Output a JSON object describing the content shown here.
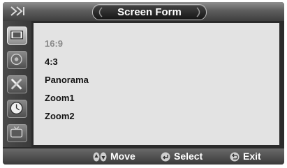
{
  "header": {
    "title": "Screen Form",
    "logo_icon": "play-chevrons-icon"
  },
  "sidebar": {
    "items": [
      {
        "icon": "picture-icon",
        "active": true
      },
      {
        "icon": "sound-icon",
        "active": false
      },
      {
        "icon": "tools-icon",
        "active": false
      },
      {
        "icon": "clock-icon",
        "active": false
      },
      {
        "icon": "tv-icon",
        "active": false
      }
    ]
  },
  "menu": {
    "options": [
      {
        "label": "16:9",
        "selected": true
      },
      {
        "label": "4:3",
        "selected": false
      },
      {
        "label": "Panorama",
        "selected": false
      },
      {
        "label": "Zoom1",
        "selected": false
      },
      {
        "label": "Zoom2",
        "selected": false
      }
    ]
  },
  "footer": {
    "move_label": "Move",
    "select_label": "Select",
    "exit_label": "Exit"
  }
}
